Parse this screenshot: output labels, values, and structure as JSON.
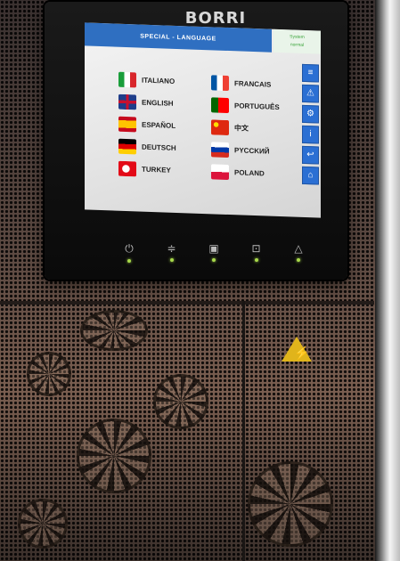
{
  "brand": "BORRI",
  "screen": {
    "title": "SPECIAL - LANGUAGE",
    "status_lines": [
      "System",
      "normal"
    ],
    "languages_left": [
      {
        "label": "ITALIANO",
        "flag": "italy-flag-icon"
      },
      {
        "label": "ENGLISH",
        "flag": "uk-flag-icon"
      },
      {
        "label": "ESPAÑOL",
        "flag": "spain-flag-icon"
      },
      {
        "label": "DEUTSCH",
        "flag": "germany-flag-icon"
      },
      {
        "label": "TURKEY",
        "flag": "turkey-flag-icon"
      }
    ],
    "languages_right": [
      {
        "label": "FRANCAIS",
        "flag": "france-flag-icon"
      },
      {
        "label": "PORTUGUÊS",
        "flag": "portugal-flag-icon"
      },
      {
        "label": "中文",
        "flag": "china-flag-icon"
      },
      {
        "label": "PYCCKИЙ",
        "flag": "russia-flag-icon"
      },
      {
        "label": "POLAND",
        "flag": "poland-flag-icon"
      }
    ],
    "side_buttons": [
      "menu-icon",
      "warning-icon",
      "settings-icon",
      "info-icon",
      "back-icon",
      "home-icon"
    ]
  },
  "front_buttons": [
    "power-icon",
    "bypass-icon",
    "battery-icon",
    "output-icon",
    "alarm-icon"
  ],
  "colors": {
    "header_blue": "#2f6fc1",
    "button_blue": "#2b6fd3",
    "led_green": "#a7d84a",
    "warning_yellow": "#e0b41b"
  }
}
